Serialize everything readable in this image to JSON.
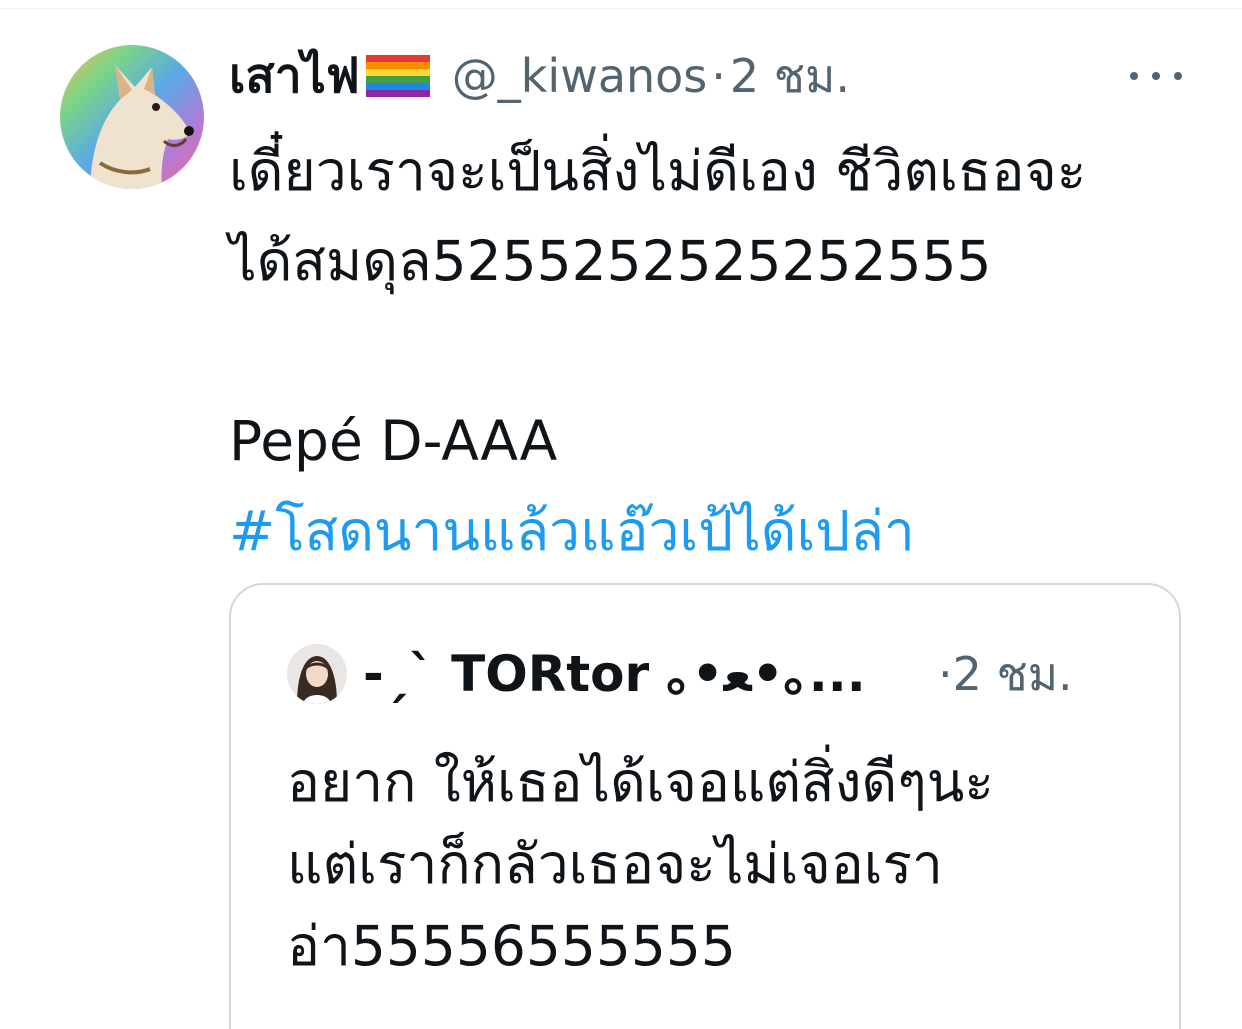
{
  "tweet": {
    "display_name": "เสาไฟ",
    "name_emoji_icon": "rainbow-flag-icon",
    "handle": "@_kiwanos",
    "separator": "·",
    "time": "2 ชม.",
    "more_icon": "more-dots-icon",
    "text_lines": [
      "เดี๋ยวเราจะเป็นสิ่งไม่ดีเอง ชีวิตเธอจะ",
      "ได้สมดุล5255252525252555"
    ],
    "signature": "Pepé D-AAA",
    "hashtag": "#โสดนานแล้วแอ๊วเป้ได้เปล่า"
  },
  "quoted_tweet": {
    "display_name": "-ˏˋ TORtor ｡•ﻌ•｡...",
    "separator": "·",
    "time": "2 ชม.",
    "text_lines": [
      "อยาก ให้เธอได้เจอแต่สิ่งดีๆนะ",
      "แต่เราก็กลัวเธอจะไม่เจอเรา",
      "อ่า55556555555"
    ]
  },
  "colors": {
    "link": "#1d9bf0",
    "secondary_text": "#536471",
    "primary_text": "#0f1419",
    "border": "#cfd9de"
  }
}
